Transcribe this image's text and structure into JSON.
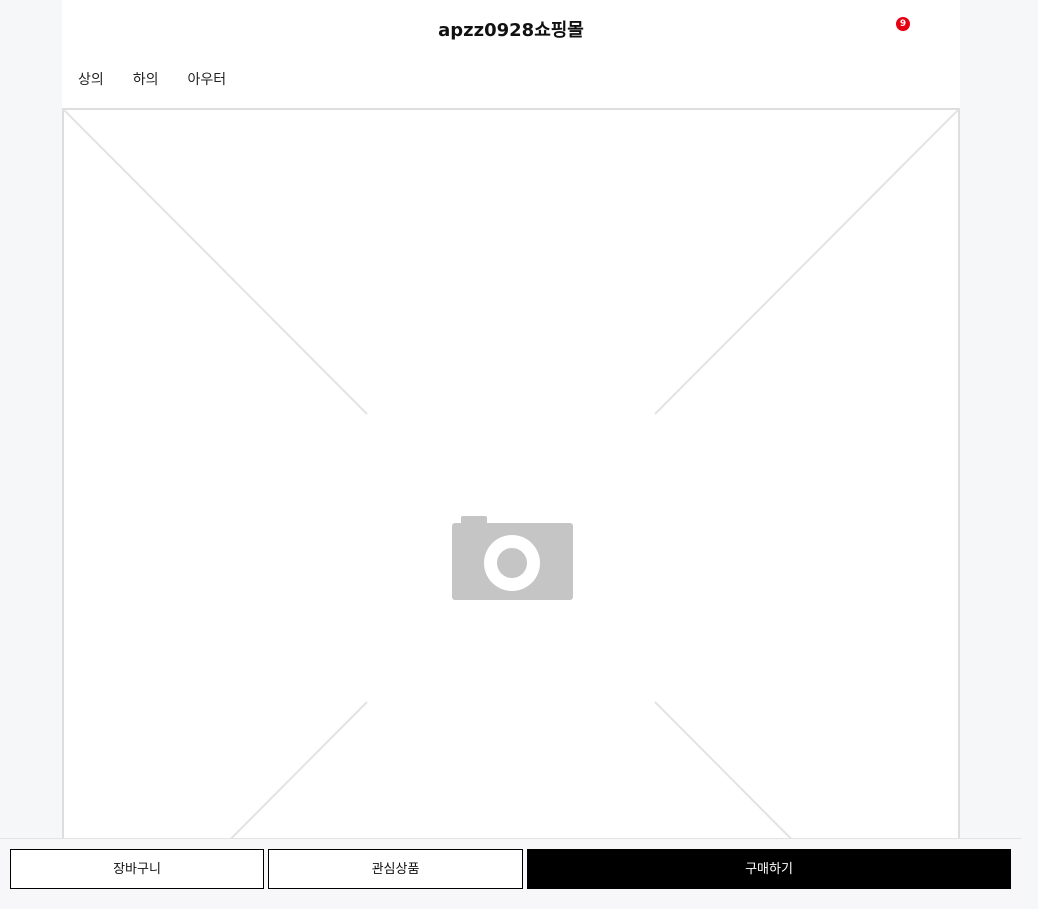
{
  "header": {
    "title": "apzz0928쇼핑몰",
    "cart_count": "9",
    "cart_icon": "shopping-cart-icon"
  },
  "nav": {
    "items": [
      {
        "label": "상의"
      },
      {
        "label": "하의"
      },
      {
        "label": "아우터"
      }
    ]
  },
  "product": {
    "image_placeholder_icon": "camera-icon"
  },
  "actions": {
    "cart_label": "장바구니",
    "wishlist_label": "관심상품",
    "buy_label": "구매하기"
  },
  "colors": {
    "badge": "#e60012",
    "buy_button": "#000000",
    "placeholder": "#c5c5c5"
  }
}
